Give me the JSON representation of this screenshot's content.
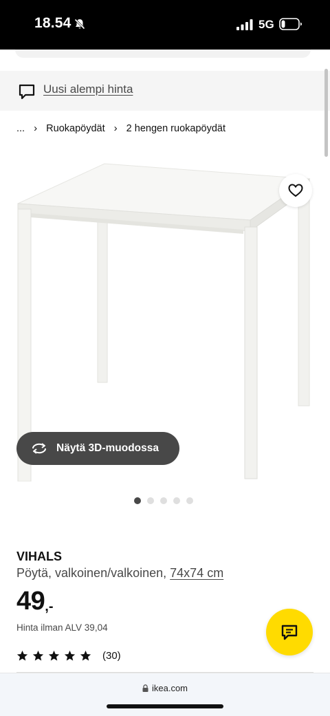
{
  "status_bar": {
    "time": "18.54",
    "network": "5G",
    "icons": [
      "bell-slash-icon",
      "signal-icon",
      "battery-icon"
    ]
  },
  "notice": {
    "link_text": "Uusi alempi hinta",
    "icon": "chat-bubble-icon"
  },
  "breadcrumb": {
    "items": [
      "...",
      "Ruokapöydät",
      "2 hengen ruokapöydät"
    ]
  },
  "image_area": {
    "view_3d_label": "Näytä 3D-muodossa",
    "carousel_count": 5,
    "carousel_active": 1,
    "icons": [
      "heart-icon",
      "rotate-3d-icon"
    ]
  },
  "product": {
    "name": "VIHALS",
    "description": "Pöytä, valkoinen/valkoinen,",
    "size": "74x74 cm",
    "price_integer": "49",
    "price_decimal": ",-",
    "price_vat": "Hinta ilman ALV 39,04",
    "rating_stars": 5,
    "rating_count": "(30)"
  },
  "fab": {
    "icon": "chat-icon",
    "color": "#ffdb00"
  },
  "browser": {
    "url": "ikea.com"
  },
  "colors": {
    "dark_button": "#484848",
    "yellow_accent": "#ffdb00",
    "banner_bg": "#f5f5f5"
  }
}
